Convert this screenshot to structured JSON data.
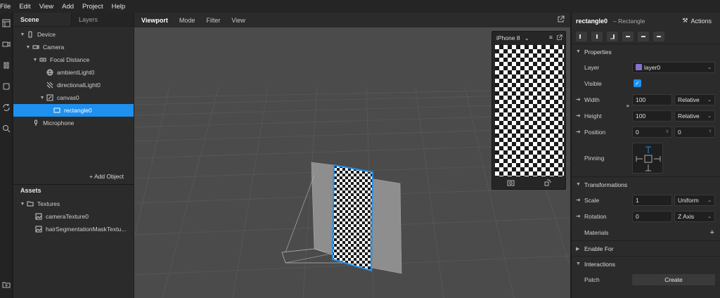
{
  "menu": [
    "File",
    "Edit",
    "View",
    "Add",
    "Project",
    "Help"
  ],
  "scene": {
    "tabs": [
      "Scene",
      "Layers"
    ],
    "tree": [
      {
        "label": "Device",
        "icon": "phone-icon"
      },
      {
        "label": "Camera",
        "icon": "camera-icon"
      },
      {
        "label": "Focal Distance",
        "icon": "focal-icon"
      },
      {
        "label": "ambientLight0",
        "icon": "globe-icon"
      },
      {
        "label": "directionalLight0",
        "icon": "light-icon"
      },
      {
        "label": "canvas0",
        "icon": "canvas-icon"
      },
      {
        "label": "rectangle0",
        "icon": "rectangle-icon"
      },
      {
        "label": "Microphone",
        "icon": "microphone-icon"
      }
    ],
    "add_object": "Add Object"
  },
  "assets": {
    "title": "Assets",
    "items": [
      {
        "label": "Textures",
        "icon": "folder-icon"
      },
      {
        "label": "cameraTexture0",
        "icon": "image-icon"
      },
      {
        "label": "hairSegmentationMaskTextu...",
        "icon": "image-icon"
      }
    ]
  },
  "viewport": {
    "tabs": [
      "Viewport",
      "Mode",
      "Filter",
      "View"
    ],
    "simulator_device": "iPhone 8"
  },
  "props": {
    "name": "rectangle0",
    "type": "– Rectangle",
    "actions": "Actions",
    "properties": "Properties",
    "layer_label": "Layer",
    "layer_value": "layer0",
    "layer_color": "#8a6fd1",
    "visible_label": "Visible",
    "width_label": "Width",
    "width_value": "100",
    "width_mode": "Relative",
    "height_label": "Height",
    "height_value": "100",
    "height_mode": "Relative",
    "position_label": "Position",
    "position_x": "0",
    "position_y": "0",
    "pinning_label": "Pinning",
    "transformations": "Transformations",
    "scale_label": "Scale",
    "scale_value": "1",
    "scale_mode": "Uniform",
    "rotation_label": "Rotation",
    "rotation_value": "0",
    "rotation_axis": "Z Axis",
    "materials_label": "Materials",
    "enable_for": "Enable For",
    "interactions": "Interactions",
    "patch_label": "Patch",
    "create_button": "Create"
  },
  "accent_color": "#1e90ef"
}
